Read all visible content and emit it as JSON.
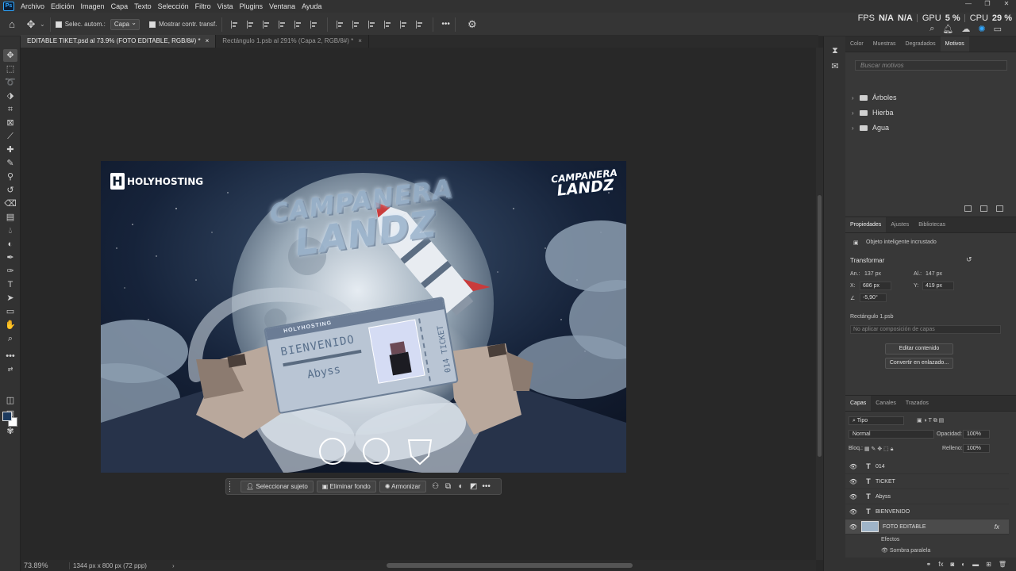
{
  "app": {
    "logo": "Ps"
  },
  "menu": [
    "Archivo",
    "Edición",
    "Imagen",
    "Capa",
    "Texto",
    "Selección",
    "Filtro",
    "Vista",
    "Plugins",
    "Ventana",
    "Ayuda"
  ],
  "window_controls": [
    "—",
    "❐",
    "✕"
  ],
  "stats": {
    "fps_label": "FPS",
    "fps_value": "N/A",
    "fps_value2": "N/A",
    "gpu_label": "GPU",
    "gpu_value": "5 %",
    "cpu_label": "CPU",
    "cpu_value": "29 %"
  },
  "options": {
    "auto_select": "Selec. autom.:",
    "auto_select_target": "Capa",
    "show_transform": "Mostrar contr. transf.",
    "more": "•••"
  },
  "tabs": [
    {
      "label": "EDITABLE TIKET.psd al 73.9% (FOTO EDITABLE, RGB/8#) *",
      "close": "×"
    },
    {
      "label": "Rectángulo 1.psb al 291% (Capa 2, RGB/8#) *",
      "close": "×"
    }
  ],
  "artwork": {
    "brand": "HOLYHOSTING",
    "brand_mark": "H",
    "badge_line1": "CAMPANERA",
    "badge_line2": "LANDZ",
    "title_line1": "CAMPANERA",
    "title_line2": "LANDZ",
    "ticket_header": "HOLYHOSTING",
    "ticket_welcome": "BIENVENIDO",
    "ticket_name": "Abyss",
    "ticket_side": "014 TICKET"
  },
  "taskbar": {
    "select_subject": "Seleccionar sujeto",
    "remove_bg": "Eliminar fondo",
    "harmonize": "Armonizar",
    "more": "•••"
  },
  "status": {
    "zoom": "73.89%",
    "doc_info": "1344 px x 800 px (72 ppp)",
    "arrow": "›"
  },
  "patterns_panel": {
    "tabs": [
      "Color",
      "Muestras",
      "Degradados",
      "Motivos"
    ],
    "active_tab": "Motivos",
    "search_placeholder": "Buscar motivos",
    "folders": [
      "Árboles",
      "Hierba",
      "Agua"
    ]
  },
  "properties_panel": {
    "tabs": [
      "Propiedades",
      "Ajustes",
      "Bibliotecas"
    ],
    "object_type": "Objeto inteligente incrustado",
    "transform_heading": "Transformar",
    "width_label": "An.:",
    "width_value": "137 px",
    "height_label": "Al.:",
    "height_value": "147 px",
    "x_label": "X:",
    "x_value": "686 px",
    "y_label": "Y:",
    "y_value": "419 px",
    "angle_value": "-5,90°",
    "source_file": "Rectángulo 1.psb",
    "composition": "No aplicar composición de capas",
    "edit_content": "Editar contenido",
    "convert_linked": "Convertir en enlazado..."
  },
  "layers_panel": {
    "tabs": [
      "Capas",
      "Canales",
      "Trazados"
    ],
    "filter": "Tipo",
    "blend_mode": "Normal",
    "opacity_label": "Opacidad:",
    "opacity_value": "100%",
    "lock_label": "Bloq.:",
    "fill_label": "Relleno:",
    "fill_value": "100%",
    "layers": [
      {
        "name": "014",
        "type": "T"
      },
      {
        "name": "TICKET",
        "type": "T"
      },
      {
        "name": "Abyss",
        "type": "T"
      },
      {
        "name": "BIENVENIDO",
        "type": "T"
      },
      {
        "name": "FOTO EDITABLE",
        "type": "smart",
        "fx": "fx"
      }
    ],
    "effects_label": "Efectos",
    "effect_item": "Sombra paralela"
  },
  "colors": {
    "accent": "#31a8ff",
    "foreground": "#1c3a5e",
    "background": "#ffffff",
    "canvas_bg": "#282828"
  }
}
